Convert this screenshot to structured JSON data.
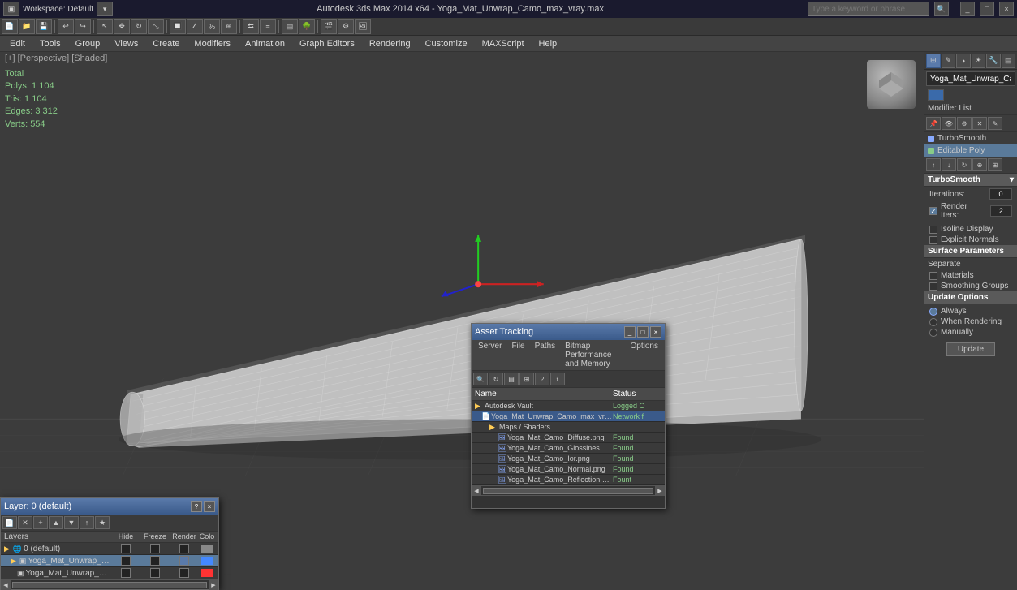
{
  "titlebar": {
    "title": "Autodesk 3ds Max 2014 x64 - Yoga_Mat_Unwrap_Camo_max_vray.max",
    "workspace_label": "Workspace: Default",
    "search_placeholder": "Type a keyword or phrase",
    "window_controls": [
      "_",
      "□",
      "×"
    ]
  },
  "menubar": {
    "items": [
      "Edit",
      "Tools",
      "Group",
      "Views",
      "Create",
      "Modifiers",
      "Animation",
      "Graph Editors",
      "Rendering",
      "Customize",
      "MAXScript",
      "Help"
    ]
  },
  "viewport": {
    "label": "[+] [Perspective] [Shaded]",
    "stats": {
      "total_label": "Total",
      "polys_label": "Polys:",
      "polys_value": "1 104",
      "tris_label": "Tris:",
      "tris_value": "1 104",
      "edges_label": "Edges:",
      "edges_value": "3 312",
      "verts_label": "Verts:",
      "verts_value": "554"
    }
  },
  "command_panel": {
    "object_name": "Yoga_Mat_Unwrap_Camo",
    "modifier_list_label": "Modifier List",
    "modifiers": [
      {
        "name": "TurboSmooth",
        "active": true
      },
      {
        "name": "Editable Poly",
        "active": true
      }
    ],
    "turbosmooth": {
      "section": "TurboSmooth",
      "iterations_label": "Iterations:",
      "iterations_value": "0",
      "render_iters_label": "Render Iters:",
      "render_iters_value": "2",
      "isoline_display_label": "Isoline Display",
      "explicit_normals_label": "Explicit Normals",
      "surface_params_label": "Surface Parameters",
      "separate_label": "Separate",
      "materials_label": "Materials",
      "smoothing_groups_label": "Smoothing Groups",
      "update_options_label": "Update Options",
      "always_label": "Always",
      "when_rendering_label": "When Rendering",
      "manually_label": "Manually",
      "update_button": "Update"
    }
  },
  "asset_tracking": {
    "title": "Asset Tracking",
    "menu": [
      "Server",
      "File",
      "Paths",
      "Bitmap Performance and Memory",
      "Options"
    ],
    "columns": [
      "Name",
      "Status"
    ],
    "rows": [
      {
        "indent": 0,
        "icon": "folder",
        "name": "Autodesk Vault",
        "status": "Logged O",
        "type": "folder"
      },
      {
        "indent": 1,
        "icon": "file",
        "name": "Yoga_Mat_Unwrap_Camo_max_vray.max",
        "status": "Network f",
        "type": "file",
        "selected": true
      },
      {
        "indent": 2,
        "icon": "folder",
        "name": "Maps / Shaders",
        "status": "",
        "type": "folder"
      },
      {
        "indent": 3,
        "icon": "image",
        "name": "Yoga_Mat_Camo_Diffuse.png",
        "status": "Found",
        "type": "image"
      },
      {
        "indent": 3,
        "icon": "image",
        "name": "Yoga_Mat_Camo_Glossines.png",
        "status": "Found",
        "type": "image"
      },
      {
        "indent": 3,
        "icon": "image",
        "name": "Yoga_Mat_Camo_Ior.png",
        "status": "Found",
        "type": "image"
      },
      {
        "indent": 3,
        "icon": "image",
        "name": "Yoga_Mat_Camo_Normal.png",
        "status": "Found",
        "type": "image"
      },
      {
        "indent": 3,
        "icon": "image",
        "name": "Yoga_Mat_Camo_Reflection.png",
        "status": "Fount",
        "type": "image"
      }
    ]
  },
  "layers": {
    "title": "Layer: 0 (default)",
    "columns": {
      "name": "Layers",
      "hide": "Hide",
      "freeze": "Freeze",
      "render": "Render",
      "color": "Colo"
    },
    "rows": [
      {
        "name": "0 (default)",
        "hide": false,
        "freeze": false,
        "render": false,
        "color": "#888888",
        "selected": false,
        "indent": 0
      },
      {
        "name": "Yoga_Mat_Unwrap_Camo",
        "hide": false,
        "freeze": false,
        "render": false,
        "color": "#aaccff",
        "selected": true,
        "indent": 1
      },
      {
        "name": "Yoga_Mat_Unwrap_Camo",
        "hide": false,
        "freeze": false,
        "render": false,
        "color": "#ff4444",
        "selected": false,
        "indent": 2
      }
    ]
  }
}
